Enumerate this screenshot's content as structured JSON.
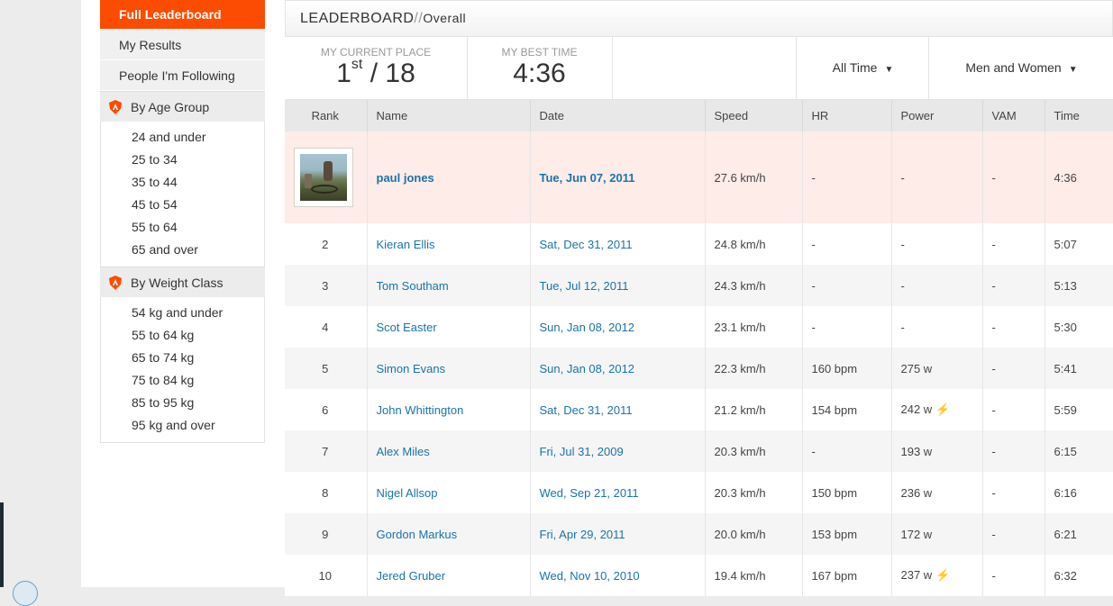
{
  "sidebar": {
    "items": [
      {
        "label": "Full Leaderboard"
      },
      {
        "label": "My Results"
      },
      {
        "label": "People I'm Following"
      }
    ],
    "age_group": {
      "title": "By Age Group",
      "items": [
        "24 and under",
        "25 to 34",
        "35 to 44",
        "45 to 54",
        "55 to 64",
        "65 and over"
      ]
    },
    "weight_class": {
      "title": "By Weight Class",
      "items": [
        "54 kg and under",
        "55 to 64 kg",
        "65 to 74 kg",
        "75 to 84 kg",
        "85 to 95 kg",
        "95 kg and over"
      ]
    },
    "accent_color": "#fc4c02"
  },
  "header": {
    "title": "LEADERBOARD",
    "separator": "//",
    "subtitle": "Overall"
  },
  "stats": {
    "place_label": "MY CURRENT PLACE",
    "place_number": "1",
    "place_suffix": "st",
    "place_total": " / 18",
    "best_label": "MY BEST TIME",
    "best_value": "4:36"
  },
  "filters": {
    "time": "All Time",
    "gender": "Men and Women"
  },
  "table": {
    "columns": [
      "Rank",
      "Name",
      "Date",
      "Speed",
      "HR",
      "Power",
      "VAM",
      "Time"
    ],
    "rows": [
      {
        "rank": "",
        "name": "paul jones",
        "date": "Tue, Jun 07, 2011",
        "speed": "27.6 km/h",
        "hr": "-",
        "power": "-",
        "vam": "-",
        "time": "4:36"
      },
      {
        "rank": "2",
        "name": "Kieran Ellis",
        "date": "Sat, Dec 31, 2011",
        "speed": "24.8 km/h",
        "hr": "-",
        "power": "-",
        "vam": "-",
        "time": "5:07"
      },
      {
        "rank": "3",
        "name": "Tom Southam",
        "date": "Tue, Jul 12, 2011",
        "speed": "24.3 km/h",
        "hr": "-",
        "power": "-",
        "vam": "-",
        "time": "5:13"
      },
      {
        "rank": "4",
        "name": "Scot Easter",
        "date": "Sun, Jan 08, 2012",
        "speed": "23.1 km/h",
        "hr": "-",
        "power": "-",
        "vam": "-",
        "time": "5:30"
      },
      {
        "rank": "5",
        "name": "Simon Evans",
        "date": "Sun, Jan 08, 2012",
        "speed": "22.3 km/h",
        "hr": "160 bpm",
        "power": "275 w",
        "vam": "-",
        "time": "5:41"
      },
      {
        "rank": "6",
        "name": "John Whittington",
        "date": "Sat, Dec 31, 2011",
        "speed": "21.2 km/h",
        "hr": "154 bpm",
        "power": "242 w",
        "vam": "-",
        "time": "5:59"
      },
      {
        "rank": "7",
        "name": "Alex Miles",
        "date": "Fri, Jul 31, 2009",
        "speed": "20.3 km/h",
        "hr": "-",
        "power": "193 w",
        "vam": "-",
        "time": "6:15"
      },
      {
        "rank": "8",
        "name": "Nigel Allsop",
        "date": "Wed, Sep 21, 2011",
        "speed": "20.3 km/h",
        "hr": "150 bpm",
        "power": "236 w",
        "vam": "-",
        "time": "6:16"
      },
      {
        "rank": "9",
        "name": "Gordon Markus",
        "date": "Fri, Apr 29, 2011",
        "speed": "20.0 km/h",
        "hr": "153 bpm",
        "power": "172 w",
        "vam": "-",
        "time": "6:21"
      },
      {
        "rank": "10",
        "name": "Jered Gruber",
        "date": "Wed, Nov 10, 2010",
        "speed": "19.4 km/h",
        "hr": "167 bpm",
        "power": "237 w",
        "vam": "-",
        "time": "6:32"
      }
    ],
    "highlight_color": "#fdece7",
    "link_color": "#1a73a8"
  }
}
